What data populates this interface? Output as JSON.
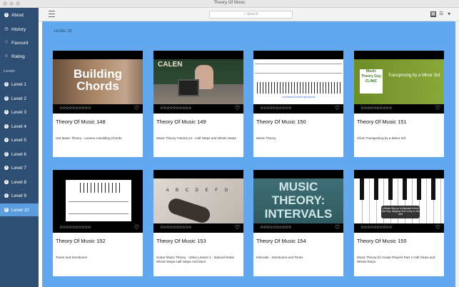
{
  "window": {
    "title": "Theory Of Music"
  },
  "toolbar": {
    "search_placeholder": "Search"
  },
  "sidebar": {
    "top_items": [
      {
        "label": "About",
        "icon": "info-icon"
      },
      {
        "label": "History",
        "icon": "clock-icon"
      },
      {
        "label": "Favourit",
        "icon": "heart-icon"
      },
      {
        "label": "Rating",
        "icon": "star-icon"
      }
    ],
    "section_label": "Levels",
    "levels": [
      "Level 1",
      "Level 2",
      "Level 3",
      "Level 4",
      "Level 5",
      "Level 6",
      "Level 7",
      "Level 8",
      "Level 9",
      "Level 10"
    ],
    "selected_level": "Level 10"
  },
  "main": {
    "heading": "LEVEL 10",
    "cards": [
      {
        "title": "Theory Of Music 148",
        "desc": "Get Music Theory - Lesson 4 Building Chords",
        "thumb_text": "Building Chords"
      },
      {
        "title": "Theory Of Music 149",
        "desc": "Music Theory Tutorial 24 - Half Steps and Whole Steps",
        "thumb_text": "CALEN"
      },
      {
        "title": "Theory Of Music 150",
        "desc": "Music Theory",
        "thumb_text": "ChordsandChordProgressions"
      },
      {
        "title": "Theory Of Music 151",
        "desc": "Clinic Transposing by a Minor 3rd",
        "thumb_text": "Music Theory Guy CLINIC",
        "thumb_sub": "Transposing by a Minor 3rd"
      },
      {
        "title": "Theory Of Music 152",
        "desc": "Tones and Semitones",
        "thumb_text": ""
      },
      {
        "title": "Theory Of Music 153",
        "desc": "Guitar Music Theory - Video Lesson 1 - Natural Notes Whole Steps  Half Steps And More",
        "thumb_text": "A B C D E F G"
      },
      {
        "title": "Theory Of Music 154",
        "desc": "Intervals - Semitones and Tones",
        "thumb_text": "MUSIC THEORY: INTERVALS"
      },
      {
        "title": "Theory Of Music 155",
        "desc": "Music Theory for Guitar Players Part 1 Half Steps and Whole Steps",
        "thumb_text": "A Whole Step on a Keyboard is from One Key, Skipping Over a Key, to the next"
      }
    ],
    "rating_stars": "☆☆☆☆☆☆☆☆☆☆"
  },
  "colors": {
    "sidebar": "#2e4f73",
    "selected": "#5b9ee0",
    "content_bg": "#62a8ee"
  }
}
